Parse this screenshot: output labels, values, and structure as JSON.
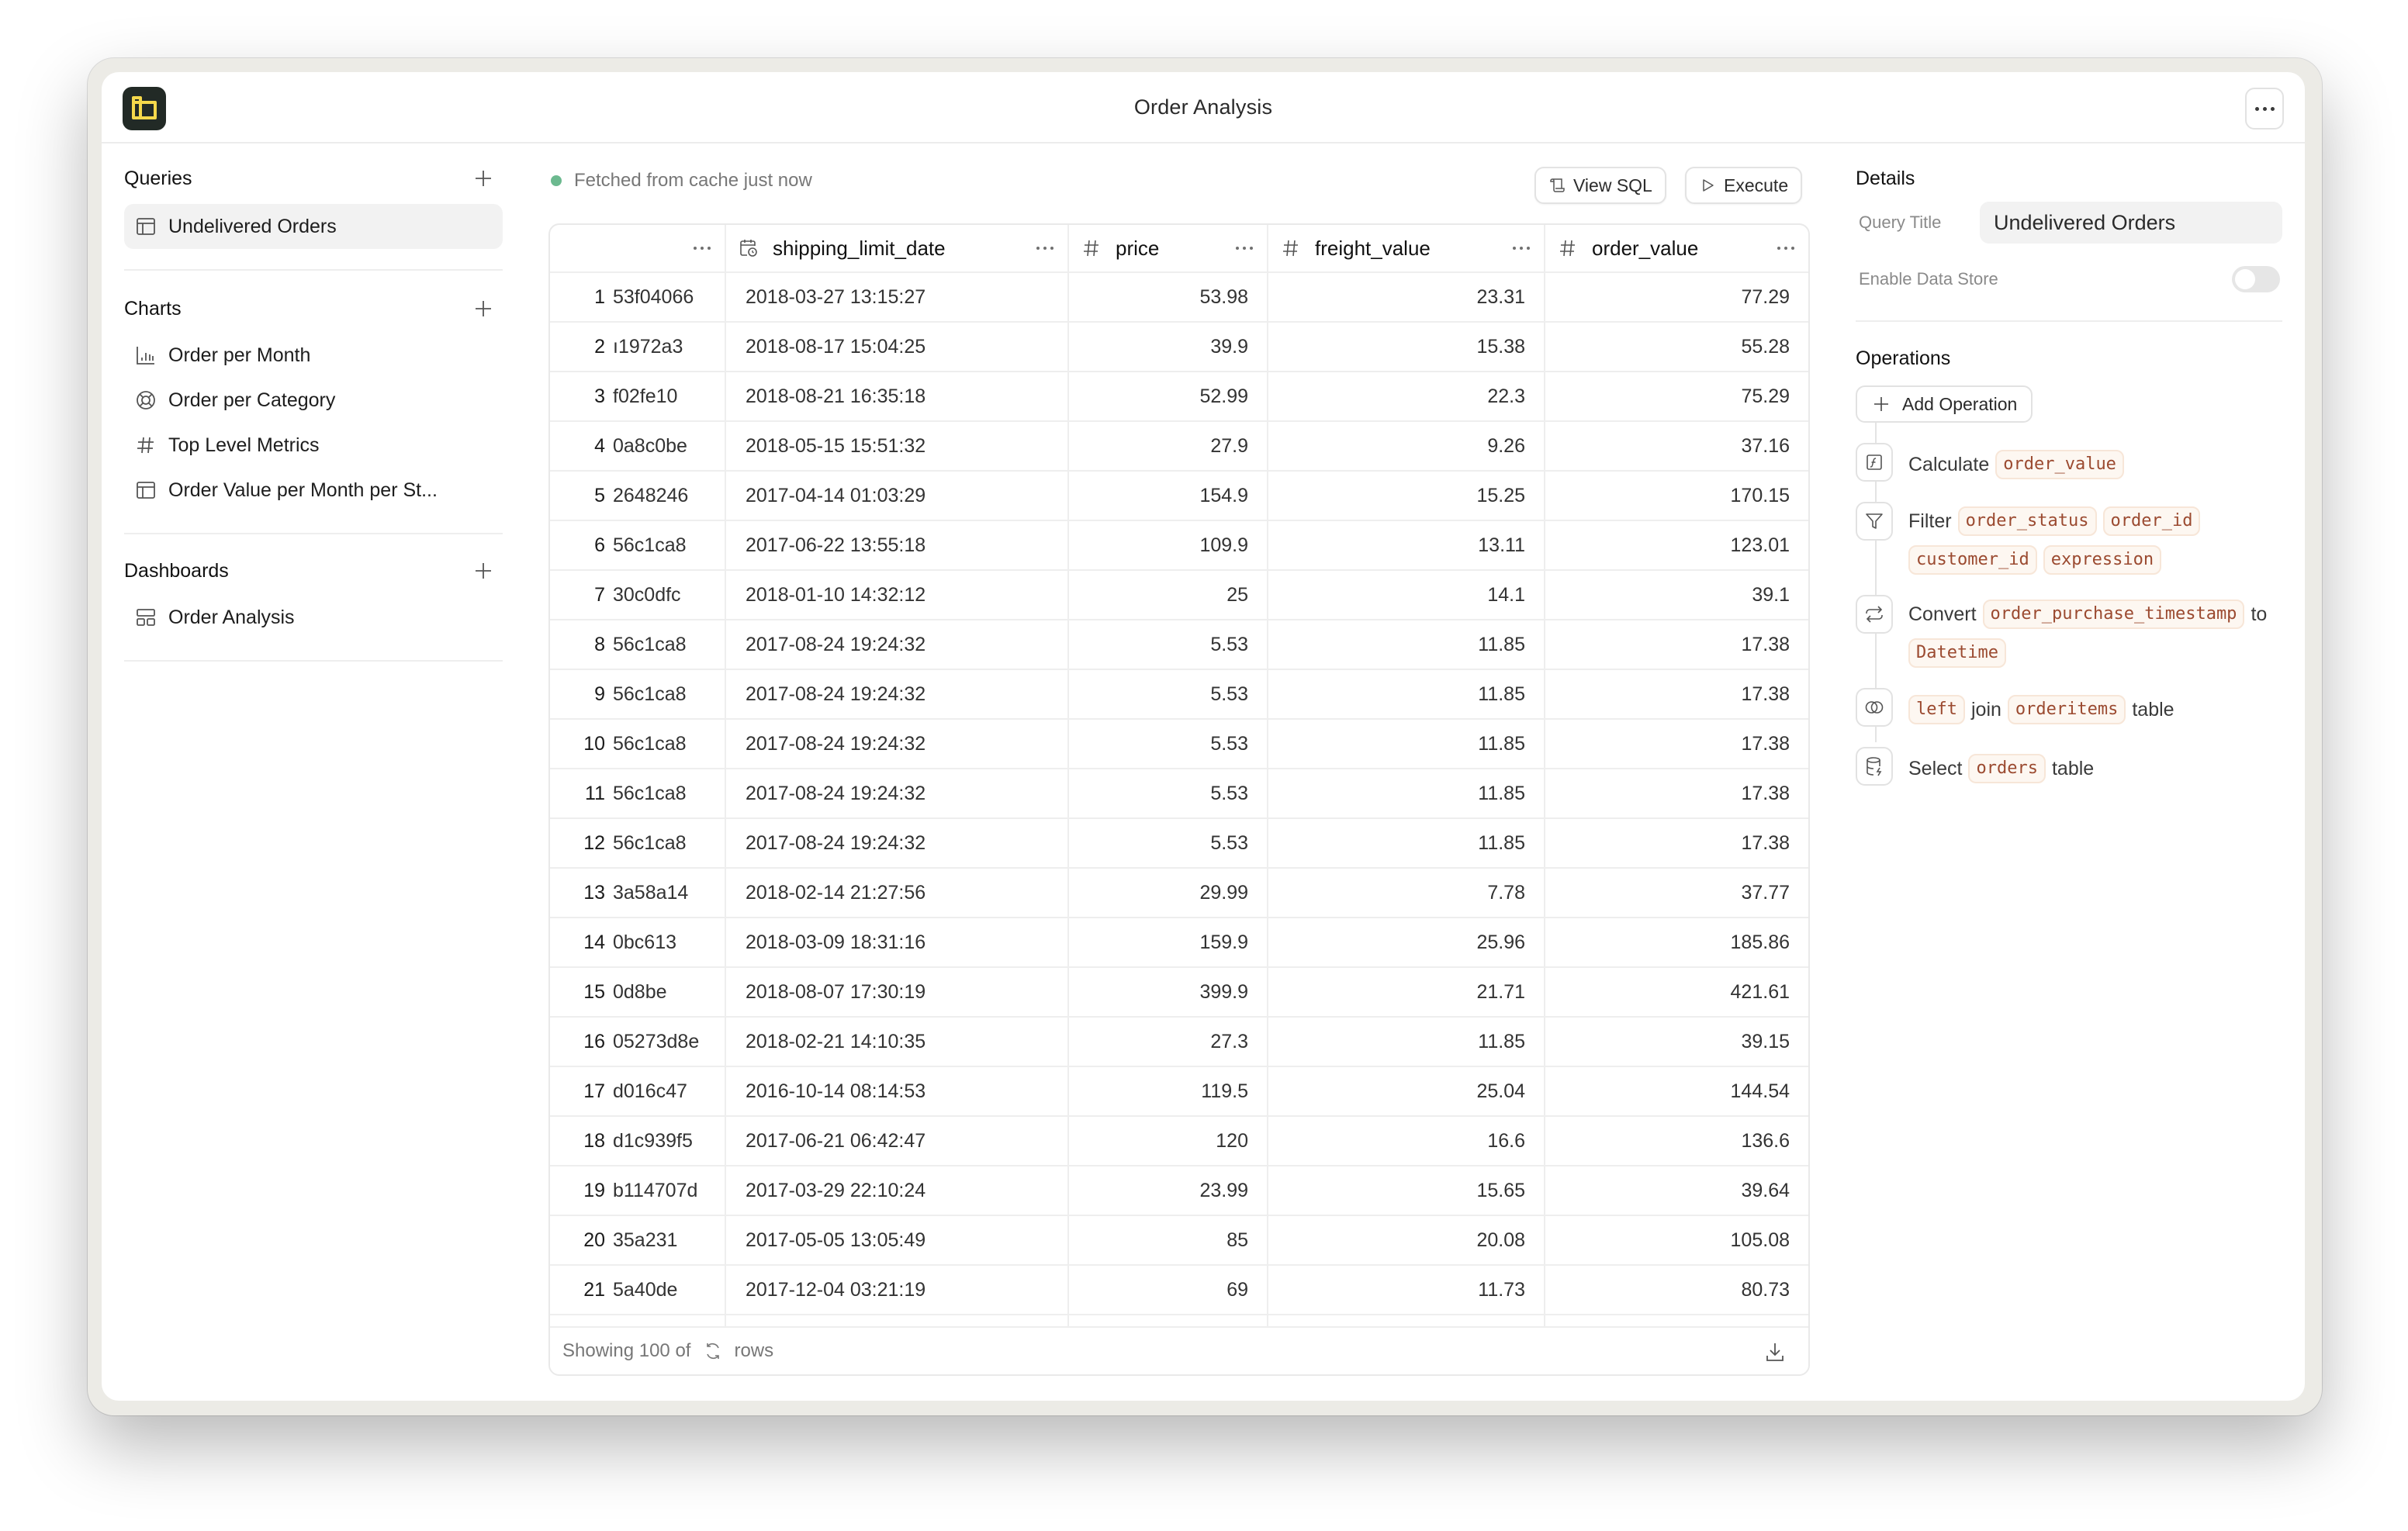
{
  "window": {
    "title": "Order Analysis",
    "logo": "app-logo",
    "menu_icon": "more-horizontal-icon"
  },
  "sidebar": {
    "queries": {
      "label": "Queries",
      "items": [
        {
          "label": "Undelivered Orders",
          "icon": "table-icon",
          "active": true
        }
      ]
    },
    "charts": {
      "label": "Charts",
      "items": [
        {
          "label": "Order per Month",
          "icon": "bar-chart-icon"
        },
        {
          "label": "Order per Category",
          "icon": "pie-chart-icon"
        },
        {
          "label": "Top Level Metrics",
          "icon": "hash-icon"
        },
        {
          "label": "Order Value per Month per St...",
          "icon": "table-icon"
        }
      ]
    },
    "dashboards": {
      "label": "Dashboards",
      "items": [
        {
          "label": "Order Analysis",
          "icon": "dashboard-layout-icon"
        }
      ]
    }
  },
  "main": {
    "status": "Fetched from cache just now",
    "status_color": "#6cb98f",
    "buttons": {
      "view_sql": "View SQL",
      "execute": "Execute"
    },
    "table": {
      "columns": [
        {
          "name": "",
          "type": "text"
        },
        {
          "name": "shipping_limit_date",
          "type": "datetime"
        },
        {
          "name": "price",
          "type": "number"
        },
        {
          "name": "freight_value",
          "type": "number"
        },
        {
          "name": "order_value",
          "type": "number"
        }
      ],
      "rows": [
        {
          "n": "1",
          "id": "53f04066",
          "date": "2018-03-27 13:15:27",
          "price": "53.98",
          "freight": "23.31",
          "order_value": "77.29"
        },
        {
          "n": "2",
          "id": "ı1972a3",
          "date": "2018-08-17 15:04:25",
          "price": "39.9",
          "freight": "15.38",
          "order_value": "55.28"
        },
        {
          "n": "3",
          "id": "f02fe10",
          "date": "2018-08-21 16:35:18",
          "price": "52.99",
          "freight": "22.3",
          "order_value": "75.29"
        },
        {
          "n": "4",
          "id": "0a8c0be",
          "date": "2018-05-15 15:51:32",
          "price": "27.9",
          "freight": "9.26",
          "order_value": "37.16"
        },
        {
          "n": "5",
          "id": "2648246",
          "date": "2017-04-14 01:03:29",
          "price": "154.9",
          "freight": "15.25",
          "order_value": "170.15"
        },
        {
          "n": "6",
          "id": "56c1ca8",
          "date": "2017-06-22 13:55:18",
          "price": "109.9",
          "freight": "13.11",
          "order_value": "123.01"
        },
        {
          "n": "7",
          "id": "30c0dfc",
          "date": "2018-01-10 14:32:12",
          "price": "25",
          "freight": "14.1",
          "order_value": "39.1"
        },
        {
          "n": "8",
          "id": "56c1ca8",
          "date": "2017-08-24 19:24:32",
          "price": "5.53",
          "freight": "11.85",
          "order_value": "17.38"
        },
        {
          "n": "9",
          "id": "56c1ca8",
          "date": "2017-08-24 19:24:32",
          "price": "5.53",
          "freight": "11.85",
          "order_value": "17.38"
        },
        {
          "n": "10",
          "id": "56c1ca8",
          "date": "2017-08-24 19:24:32",
          "price": "5.53",
          "freight": "11.85",
          "order_value": "17.38"
        },
        {
          "n": "11",
          "id": "56c1ca8",
          "date": "2017-08-24 19:24:32",
          "price": "5.53",
          "freight": "11.85",
          "order_value": "17.38"
        },
        {
          "n": "12",
          "id": "56c1ca8",
          "date": "2017-08-24 19:24:32",
          "price": "5.53",
          "freight": "11.85",
          "order_value": "17.38"
        },
        {
          "n": "13",
          "id": "3a58a14",
          "date": "2018-02-14 21:27:56",
          "price": "29.99",
          "freight": "7.78",
          "order_value": "37.77"
        },
        {
          "n": "14",
          "id": "0bc613",
          "date": "2018-03-09 18:31:16",
          "price": "159.9",
          "freight": "25.96",
          "order_value": "185.86"
        },
        {
          "n": "15",
          "id": "0d8be",
          "date": "2018-08-07 17:30:19",
          "price": "399.9",
          "freight": "21.71",
          "order_value": "421.61"
        },
        {
          "n": "16",
          "id": "05273d8e",
          "date": "2018-02-21 14:10:35",
          "price": "27.3",
          "freight": "11.85",
          "order_value": "39.15"
        },
        {
          "n": "17",
          "id": "d016c47",
          "date": "2016-10-14 08:14:53",
          "price": "119.5",
          "freight": "25.04",
          "order_value": "144.54"
        },
        {
          "n": "18",
          "id": "d1c939f5",
          "date": "2017-06-21 06:42:47",
          "price": "120",
          "freight": "16.6",
          "order_value": "136.6"
        },
        {
          "n": "19",
          "id": "b114707d",
          "date": "2017-03-29 22:10:24",
          "price": "23.99",
          "freight": "15.65",
          "order_value": "39.64"
        },
        {
          "n": "20",
          "id": "35a231",
          "date": "2017-05-05 13:05:49",
          "price": "85",
          "freight": "20.08",
          "order_value": "105.08"
        },
        {
          "n": "21",
          "id": "5a40de",
          "date": "2017-12-04 03:21:19",
          "price": "69",
          "freight": "11.73",
          "order_value": "80.73"
        }
      ],
      "footer": {
        "showing_prefix": "Showing 100 of",
        "showing_suffix": "rows",
        "total_icon": "refresh-icon",
        "download_icon": "download-icon"
      }
    }
  },
  "details": {
    "title": "Details",
    "query_title_label": "Query Title",
    "query_title_value": "Undelivered Orders",
    "data_store_label": "Enable Data Store",
    "data_store_enabled": false
  },
  "operations": {
    "title": "Operations",
    "add_label": "Add Operation",
    "items": [
      {
        "icon": "function-icon",
        "parts": [
          {
            "t": "text",
            "v": "Calculate"
          },
          {
            "t": "chip",
            "v": "order_value"
          }
        ]
      },
      {
        "icon": "filter-icon",
        "parts": [
          {
            "t": "text",
            "v": "Filter"
          },
          {
            "t": "chip",
            "v": "order_status"
          },
          {
            "t": "chip",
            "v": "order_id"
          },
          {
            "t": "chip",
            "v": "customer_id"
          },
          {
            "t": "chip",
            "v": "expression"
          }
        ]
      },
      {
        "icon": "convert-icon",
        "parts": [
          {
            "t": "text",
            "v": "Convert"
          },
          {
            "t": "chip",
            "v": "order_purchase_timestamp"
          },
          {
            "t": "text",
            "v": "to"
          },
          {
            "t": "chip",
            "v": "Datetime"
          }
        ]
      },
      {
        "icon": "join-icon",
        "parts": [
          {
            "t": "chip",
            "v": "left"
          },
          {
            "t": "text",
            "v": "join"
          },
          {
            "t": "chip",
            "v": "orderitems"
          },
          {
            "t": "text",
            "v": "table"
          }
        ]
      },
      {
        "icon": "database-icon",
        "parts": [
          {
            "t": "text",
            "v": "Select"
          },
          {
            "t": "chip",
            "v": "orders"
          },
          {
            "t": "text",
            "v": "table"
          }
        ]
      }
    ]
  },
  "colors": {
    "logo_bg": "#222a26",
    "logo_fg": "#f5d84b",
    "chip_text": "#9b4a30",
    "chip_bg": "#fdf7f1",
    "status_dot": "#6cb98f"
  }
}
